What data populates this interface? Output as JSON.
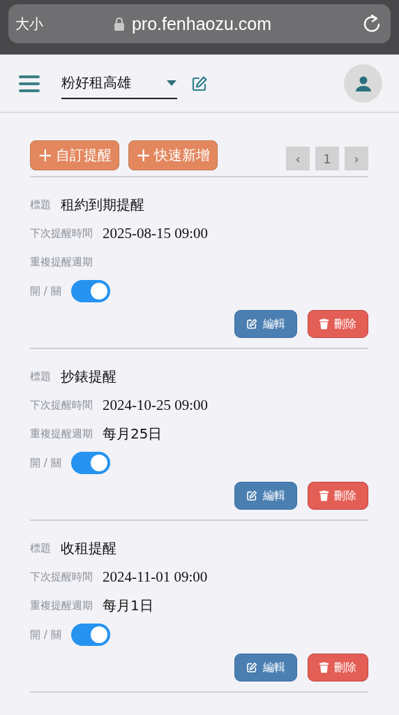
{
  "browser": {
    "text_size": "大小",
    "url": "pro.fenhaozu.com"
  },
  "header": {
    "store": "粉好租高雄"
  },
  "toolbar": {
    "buttons": [
      {
        "icon": "+",
        "label": "自訂提醒"
      },
      {
        "icon": "+",
        "label": "快速新增"
      }
    ],
    "pagination": {
      "prev": "‹",
      "page": "1",
      "next": "›"
    }
  },
  "reminders": [
    {
      "title_label": "標題",
      "title": "租約到期提醒",
      "time_label": "下次提醒時間",
      "time": "2025-08-15 09:00",
      "repeat_label": "重複提醒週期",
      "toggle_label": "開 / 關",
      "on": true,
      "edit": "編輯",
      "delete": "刪除"
    },
    {
      "title_label": "標題",
      "title": "抄錶提醒",
      "time_label": "下次提醒時間",
      "time": "2024-10-25 09:00",
      "repeat_label": "重複提醒週期",
      "repeat": "每月25日",
      "toggle_label": "開 / 關",
      "on": true,
      "edit": "編輯",
      "delete": "刪除"
    },
    {
      "title_label": "標題",
      "title": "收租提醒",
      "time_label": "下次提醒時間",
      "time": "2024-11-01 09:00",
      "repeat_label": "重複提醒週期",
      "repeat": "每月1日",
      "toggle_label": "開 / 關",
      "on": true,
      "edit": "編輯",
      "delete": "刪除"
    }
  ]
}
